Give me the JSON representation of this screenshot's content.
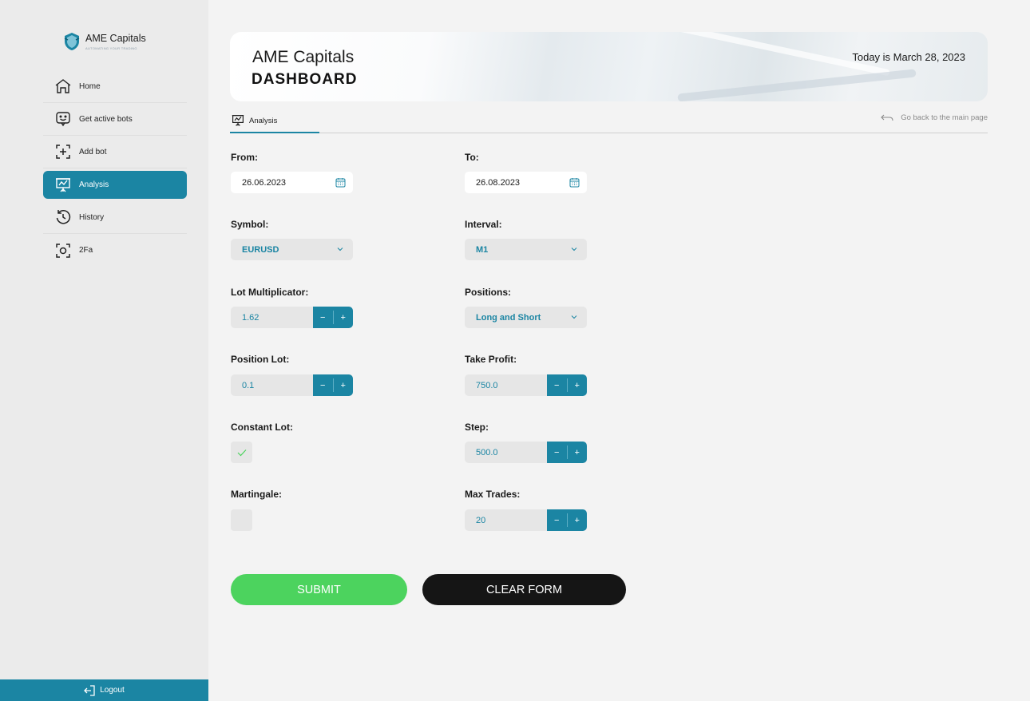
{
  "brand": {
    "name": "AME Capitals",
    "tagline": "AUTOMATING YOUR TRADING"
  },
  "sidebar": {
    "items": [
      {
        "label": "Home",
        "icon": "home-icon"
      },
      {
        "label": "Get active bots",
        "icon": "bot-face-icon"
      },
      {
        "label": "Add bot",
        "icon": "add-bot-icon"
      },
      {
        "label": "Analysis",
        "icon": "presentation-chart-icon",
        "active": true
      },
      {
        "label": "History",
        "icon": "history-icon"
      },
      {
        "label": "2Fa",
        "icon": "face-scan-icon"
      }
    ],
    "logout": "Logout"
  },
  "header": {
    "title": "AME Capitals",
    "subtitle": "DASHBOARD",
    "date": "Today is March 28, 2023"
  },
  "tabs": {
    "active": "Analysis",
    "back_link": "Go back to the main page"
  },
  "form": {
    "from": {
      "label": "From:",
      "value": "26.06.2023"
    },
    "to": {
      "label": "To:",
      "value": "26.08.2023"
    },
    "symbol": {
      "label": "Symbol:",
      "value": "EURUSD"
    },
    "interval": {
      "label": "Interval:",
      "value": "M1"
    },
    "lot_multiplicator": {
      "label": "Lot Multiplicator:",
      "value": "1.62"
    },
    "positions": {
      "label": "Positions:",
      "value": "Long and Short"
    },
    "position_lot": {
      "label": "Position Lot:",
      "value": "0.1"
    },
    "take_profit": {
      "label": "Take Profit:",
      "value": "750.0"
    },
    "constant_lot": {
      "label": "Constant Lot:",
      "checked": true
    },
    "step": {
      "label": "Step:",
      "value": "500.0"
    },
    "martingale": {
      "label": "Martingale:",
      "checked": false
    },
    "max_trades": {
      "label": "Max Trades:",
      "value": "20"
    },
    "stepper_minus": "−",
    "stepper_plus": "+"
  },
  "buttons": {
    "submit": "SUBMIT",
    "clear": "CLEAR FORM"
  },
  "colors": {
    "accent": "#1b85a3",
    "submit": "#4cd35e",
    "clear": "#151515",
    "check": "#4cd35e"
  }
}
